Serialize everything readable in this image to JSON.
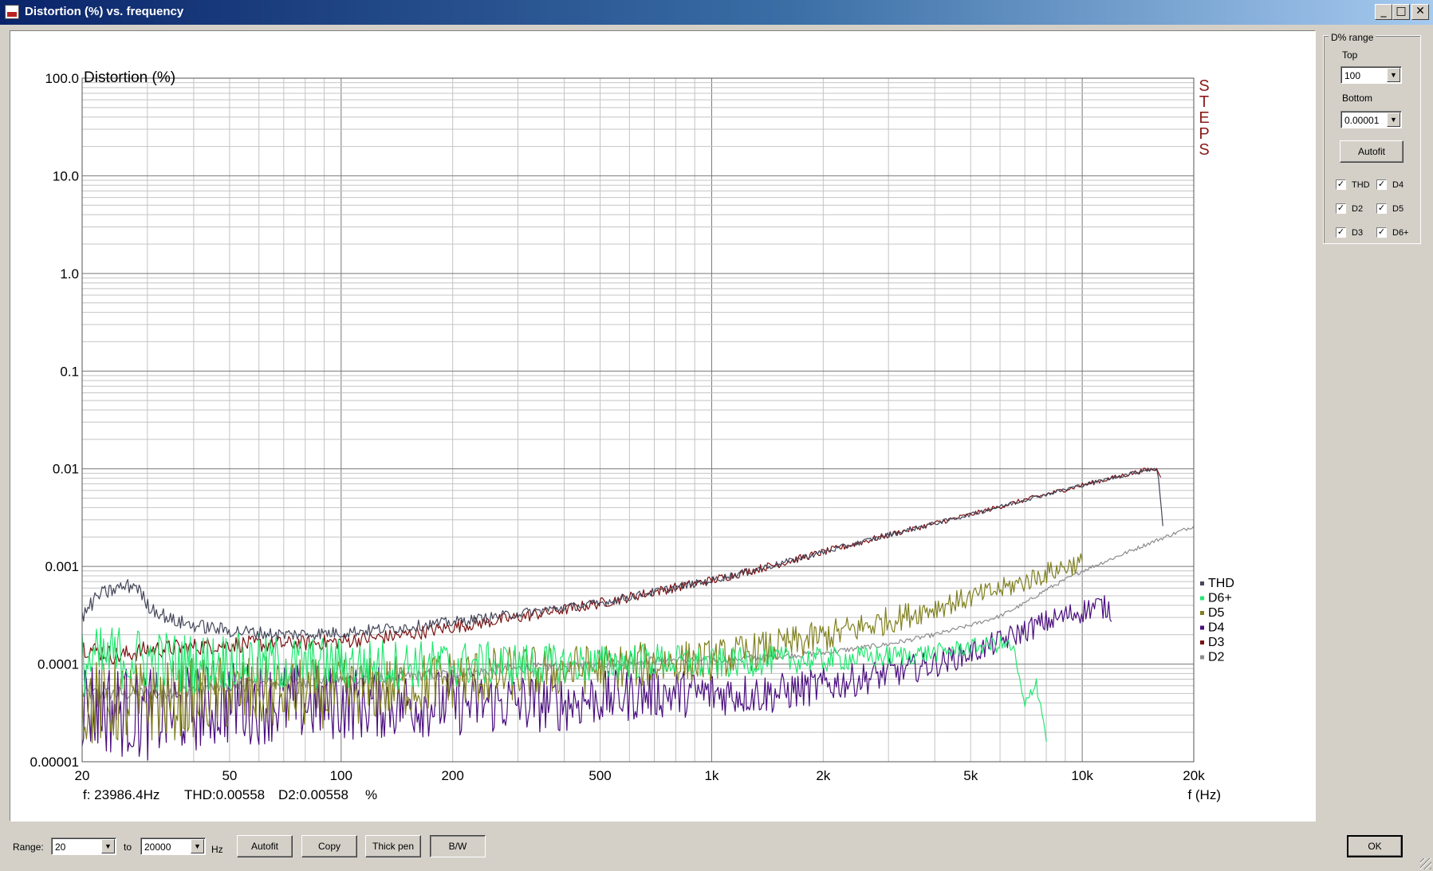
{
  "window": {
    "title": "Distortion (%) vs. frequency",
    "controls": {
      "minimize": "_",
      "maximize": "□",
      "close": "✕"
    },
    "icon": "app-icon"
  },
  "chart_data": {
    "type": "line",
    "ylabel": "Distortion (%)",
    "xlabel": "f (Hz)",
    "x_scale": "log",
    "y_scale": "log",
    "xlim": [
      20,
      20000
    ],
    "ylim": [
      1e-05,
      100
    ],
    "x_ticks": [
      {
        "v": 20,
        "label": "20"
      },
      {
        "v": 50,
        "label": "50"
      },
      {
        "v": 100,
        "label": "100"
      },
      {
        "v": 200,
        "label": "200"
      },
      {
        "v": 500,
        "label": "500"
      },
      {
        "v": 1000,
        "label": "1k"
      },
      {
        "v": 2000,
        "label": "2k"
      },
      {
        "v": 5000,
        "label": "5k"
      },
      {
        "v": 10000,
        "label": "10k"
      },
      {
        "v": 20000,
        "label": "20k"
      }
    ],
    "y_ticks": [
      {
        "v": 100,
        "label": "100.0"
      },
      {
        "v": 10,
        "label": "10.0"
      },
      {
        "v": 1,
        "label": "1.0"
      },
      {
        "v": 0.1,
        "label": "0.1"
      },
      {
        "v": 0.01,
        "label": "0.01"
      },
      {
        "v": 0.001,
        "label": "0.001"
      },
      {
        "v": 0.0001,
        "label": "0.0001"
      },
      {
        "v": 1e-05,
        "label": "0.00001"
      }
    ],
    "grid": true,
    "watermark": "STEPS",
    "watermark_color": "#8b1a1a",
    "legend_position": "bottom-right",
    "readout": {
      "freq": "f: 23986.4Hz",
      "thd": "THD:0.00558",
      "d2": "D2:0.00558",
      "unit": "%"
    },
    "series": [
      {
        "name": "THD",
        "color": "#44465a",
        "x": [
          20,
          22,
          25,
          28,
          30,
          35,
          40,
          50,
          70,
          100,
          150,
          200,
          250,
          300,
          500,
          700,
          1000,
          1500,
          2000,
          3000,
          5000,
          7000,
          10000,
          15000,
          16000,
          16500
        ],
        "y": [
          0.0003,
          0.0005,
          0.0006,
          0.00065,
          0.0004,
          0.00028,
          0.00025,
          0.00022,
          0.0002,
          0.00021,
          0.00024,
          0.00027,
          0.0003,
          0.00033,
          0.00042,
          0.00055,
          0.00072,
          0.00105,
          0.0014,
          0.0021,
          0.0034,
          0.0048,
          0.0068,
          0.0098,
          0.0098,
          0.0026
        ]
      },
      {
        "name": "D6+",
        "color": "#22e870",
        "x": [
          20,
          25,
          30,
          40,
          50,
          70,
          100,
          150,
          200,
          300,
          500,
          700,
          1000,
          1500,
          2000,
          3000,
          4000,
          5000,
          6000,
          6500,
          7000,
          7500,
          8000
        ],
        "y": [
          0.0001,
          0.00012,
          0.00011,
          0.0001,
          0.00011,
          0.0001,
          0.0001,
          0.0001,
          0.0001,
          0.0001,
          0.0001,
          0.00011,
          0.0001,
          0.00011,
          0.00011,
          0.00012,
          0.00013,
          0.00015,
          0.00016,
          0.00015,
          3.5e-05,
          7e-05,
          1.8e-05
        ]
      },
      {
        "name": "D5",
        "color": "#808020",
        "x": [
          20,
          30,
          50,
          70,
          100,
          150,
          200,
          300,
          500,
          700,
          1000,
          1500,
          2000,
          3000,
          4000,
          5000,
          6000,
          7000,
          8000,
          9000,
          10000
        ],
        "y": [
          4e-05,
          4e-05,
          5e-05,
          5e-05,
          5e-05,
          6e-05,
          7e-05,
          8e-05,
          9e-05,
          0.0001,
          0.00011,
          0.00015,
          0.00019,
          0.00028,
          0.00038,
          0.00048,
          0.00058,
          0.0007,
          0.00085,
          0.001,
          0.0011
        ]
      },
      {
        "name": "D4",
        "color": "#4a0e7e",
        "x": [
          20,
          30,
          50,
          70,
          100,
          150,
          200,
          300,
          400,
          500,
          700,
          1000,
          1500,
          2000,
          2500,
          3000,
          4000,
          5000,
          6000,
          7000,
          8000,
          9000,
          10000,
          11000,
          12000
        ],
        "y": [
          4e-05,
          3e-05,
          4e-05,
          4e-05,
          4e-05,
          4e-05,
          4e-05,
          4e-05,
          4e-05,
          4.5e-05,
          5e-05,
          5e-05,
          5e-05,
          6e-05,
          7e-05,
          8e-05,
          0.0001,
          0.00013,
          0.00017,
          0.00022,
          0.00027,
          0.00031,
          0.00035,
          0.0004,
          0.00036
        ]
      },
      {
        "name": "D3",
        "color": "#7b1010",
        "x": [
          20,
          25,
          30,
          40,
          50,
          70,
          100,
          150,
          200,
          300,
          500,
          700,
          1000,
          1500,
          2000,
          3000,
          5000,
          7000,
          10000,
          15000,
          16000,
          16300
        ],
        "y": [
          0.00015,
          0.00012,
          0.00014,
          0.00015,
          0.00016,
          0.00016,
          0.00017,
          0.0002,
          0.00024,
          0.0003,
          0.00042,
          0.00055,
          0.00072,
          0.00105,
          0.0014,
          0.0021,
          0.0034,
          0.0048,
          0.0068,
          0.0098,
          0.0098,
          0.0084
        ]
      },
      {
        "name": "D2",
        "color": "#8c8c8c",
        "x": [
          20,
          30,
          50,
          100,
          200,
          300,
          500,
          700,
          1000,
          1500,
          2000,
          3000,
          4000,
          5000,
          6000,
          7000,
          8000,
          10000,
          15000,
          20000
        ],
        "y": [
          5e-05,
          5e-05,
          6e-05,
          7e-05,
          8e-05,
          9e-05,
          0.0001,
          0.00011,
          0.00011,
          0.00012,
          0.00013,
          0.00016,
          0.0002,
          0.00025,
          0.00031,
          0.00042,
          0.00058,
          0.0009,
          0.0017,
          0.0026
        ]
      }
    ]
  },
  "side_panel": {
    "group_title": "D% range",
    "top_label": "Top",
    "top_value": "100",
    "bottom_label": "Bottom",
    "bottom_value": "0.00001",
    "autofit": "Autofit",
    "checks": [
      {
        "label": "THD",
        "checked": true
      },
      {
        "label": "D4",
        "checked": true
      },
      {
        "label": "D2",
        "checked": true
      },
      {
        "label": "D5",
        "checked": true
      },
      {
        "label": "D3",
        "checked": true
      },
      {
        "label": "D6+",
        "checked": true
      }
    ],
    "check_mark": "✓"
  },
  "bottom_bar": {
    "range_label": "Range:",
    "from_value": "20",
    "to_label": "to",
    "to_value": "20000",
    "unit": "Hz",
    "autofit": "Autofit",
    "copy": "Copy",
    "thick_pen": "Thick pen",
    "bw": "B/W",
    "ok": "OK"
  }
}
